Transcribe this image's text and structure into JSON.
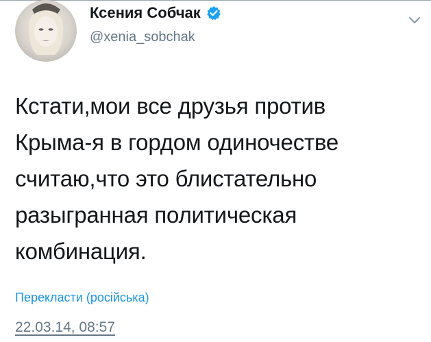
{
  "author": {
    "display_name": "Ксения Собчак",
    "handle": "@xenia_sobchak",
    "verified": true,
    "avatar_icon": "profile-photo-avatar"
  },
  "menu": {
    "icon": "chevron-down-icon"
  },
  "tweet": {
    "text": "Кстати,мои все друзья против\nКрыма-я в гордом одиночестве\nсчитаю,что это блистательно\nразыгранная политическая\nкомбинация.",
    "translate_label": "Перекласти (російська)",
    "timestamp": "22.03.14, 08:57"
  },
  "colors": {
    "verified_blue": "#1da1f2",
    "link_blue": "#1b95e0",
    "secondary_gray": "#657786",
    "text_dark": "#14171a"
  }
}
